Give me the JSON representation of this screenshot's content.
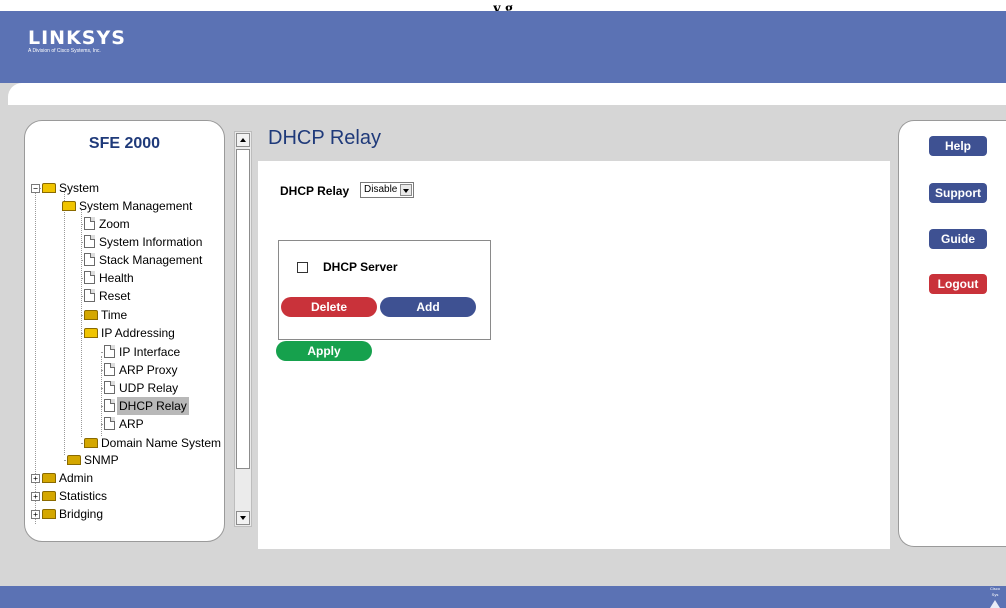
{
  "top_title": "y g",
  "brand": {
    "name": "LINKSYS",
    "tagline": "A Division of Cisco Systems, Inc."
  },
  "sidebar": {
    "title": "SFE 2000",
    "tree": [
      {
        "label": "System",
        "expander": "−"
      },
      {
        "label": "System Management"
      },
      {
        "label": "Zoom"
      },
      {
        "label": "System Information"
      },
      {
        "label": "Stack Management"
      },
      {
        "label": "Health"
      },
      {
        "label": "Reset"
      },
      {
        "label": "Time"
      },
      {
        "label": "IP Addressing"
      },
      {
        "label": "IP Interface"
      },
      {
        "label": "ARP Proxy"
      },
      {
        "label": "UDP Relay"
      },
      {
        "label": "DHCP Relay",
        "selected": true
      },
      {
        "label": "ARP"
      },
      {
        "label": "Domain Name System"
      },
      {
        "label": "SNMP"
      },
      {
        "label": "Admin",
        "expander": "+"
      },
      {
        "label": "Statistics",
        "expander": "+"
      },
      {
        "label": "Bridging",
        "expander": "+"
      }
    ]
  },
  "main": {
    "title": "DHCP Relay",
    "relay_label": "DHCP Relay",
    "relay_value": "Disable",
    "server_label": "DHCP Server",
    "delete_label": "Delete",
    "add_label": "Add",
    "apply_label": "Apply"
  },
  "right": {
    "help": "Help",
    "support": "Support",
    "guide": "Guide",
    "logout": "Logout"
  },
  "footer": {
    "logo_text": "Cisco Sys"
  },
  "colors": {
    "header": "#5b72b4",
    "blue_button": "#3e5192",
    "red_button": "#c9323a",
    "green_button": "#16a14d",
    "title": "#1f3a7a"
  }
}
